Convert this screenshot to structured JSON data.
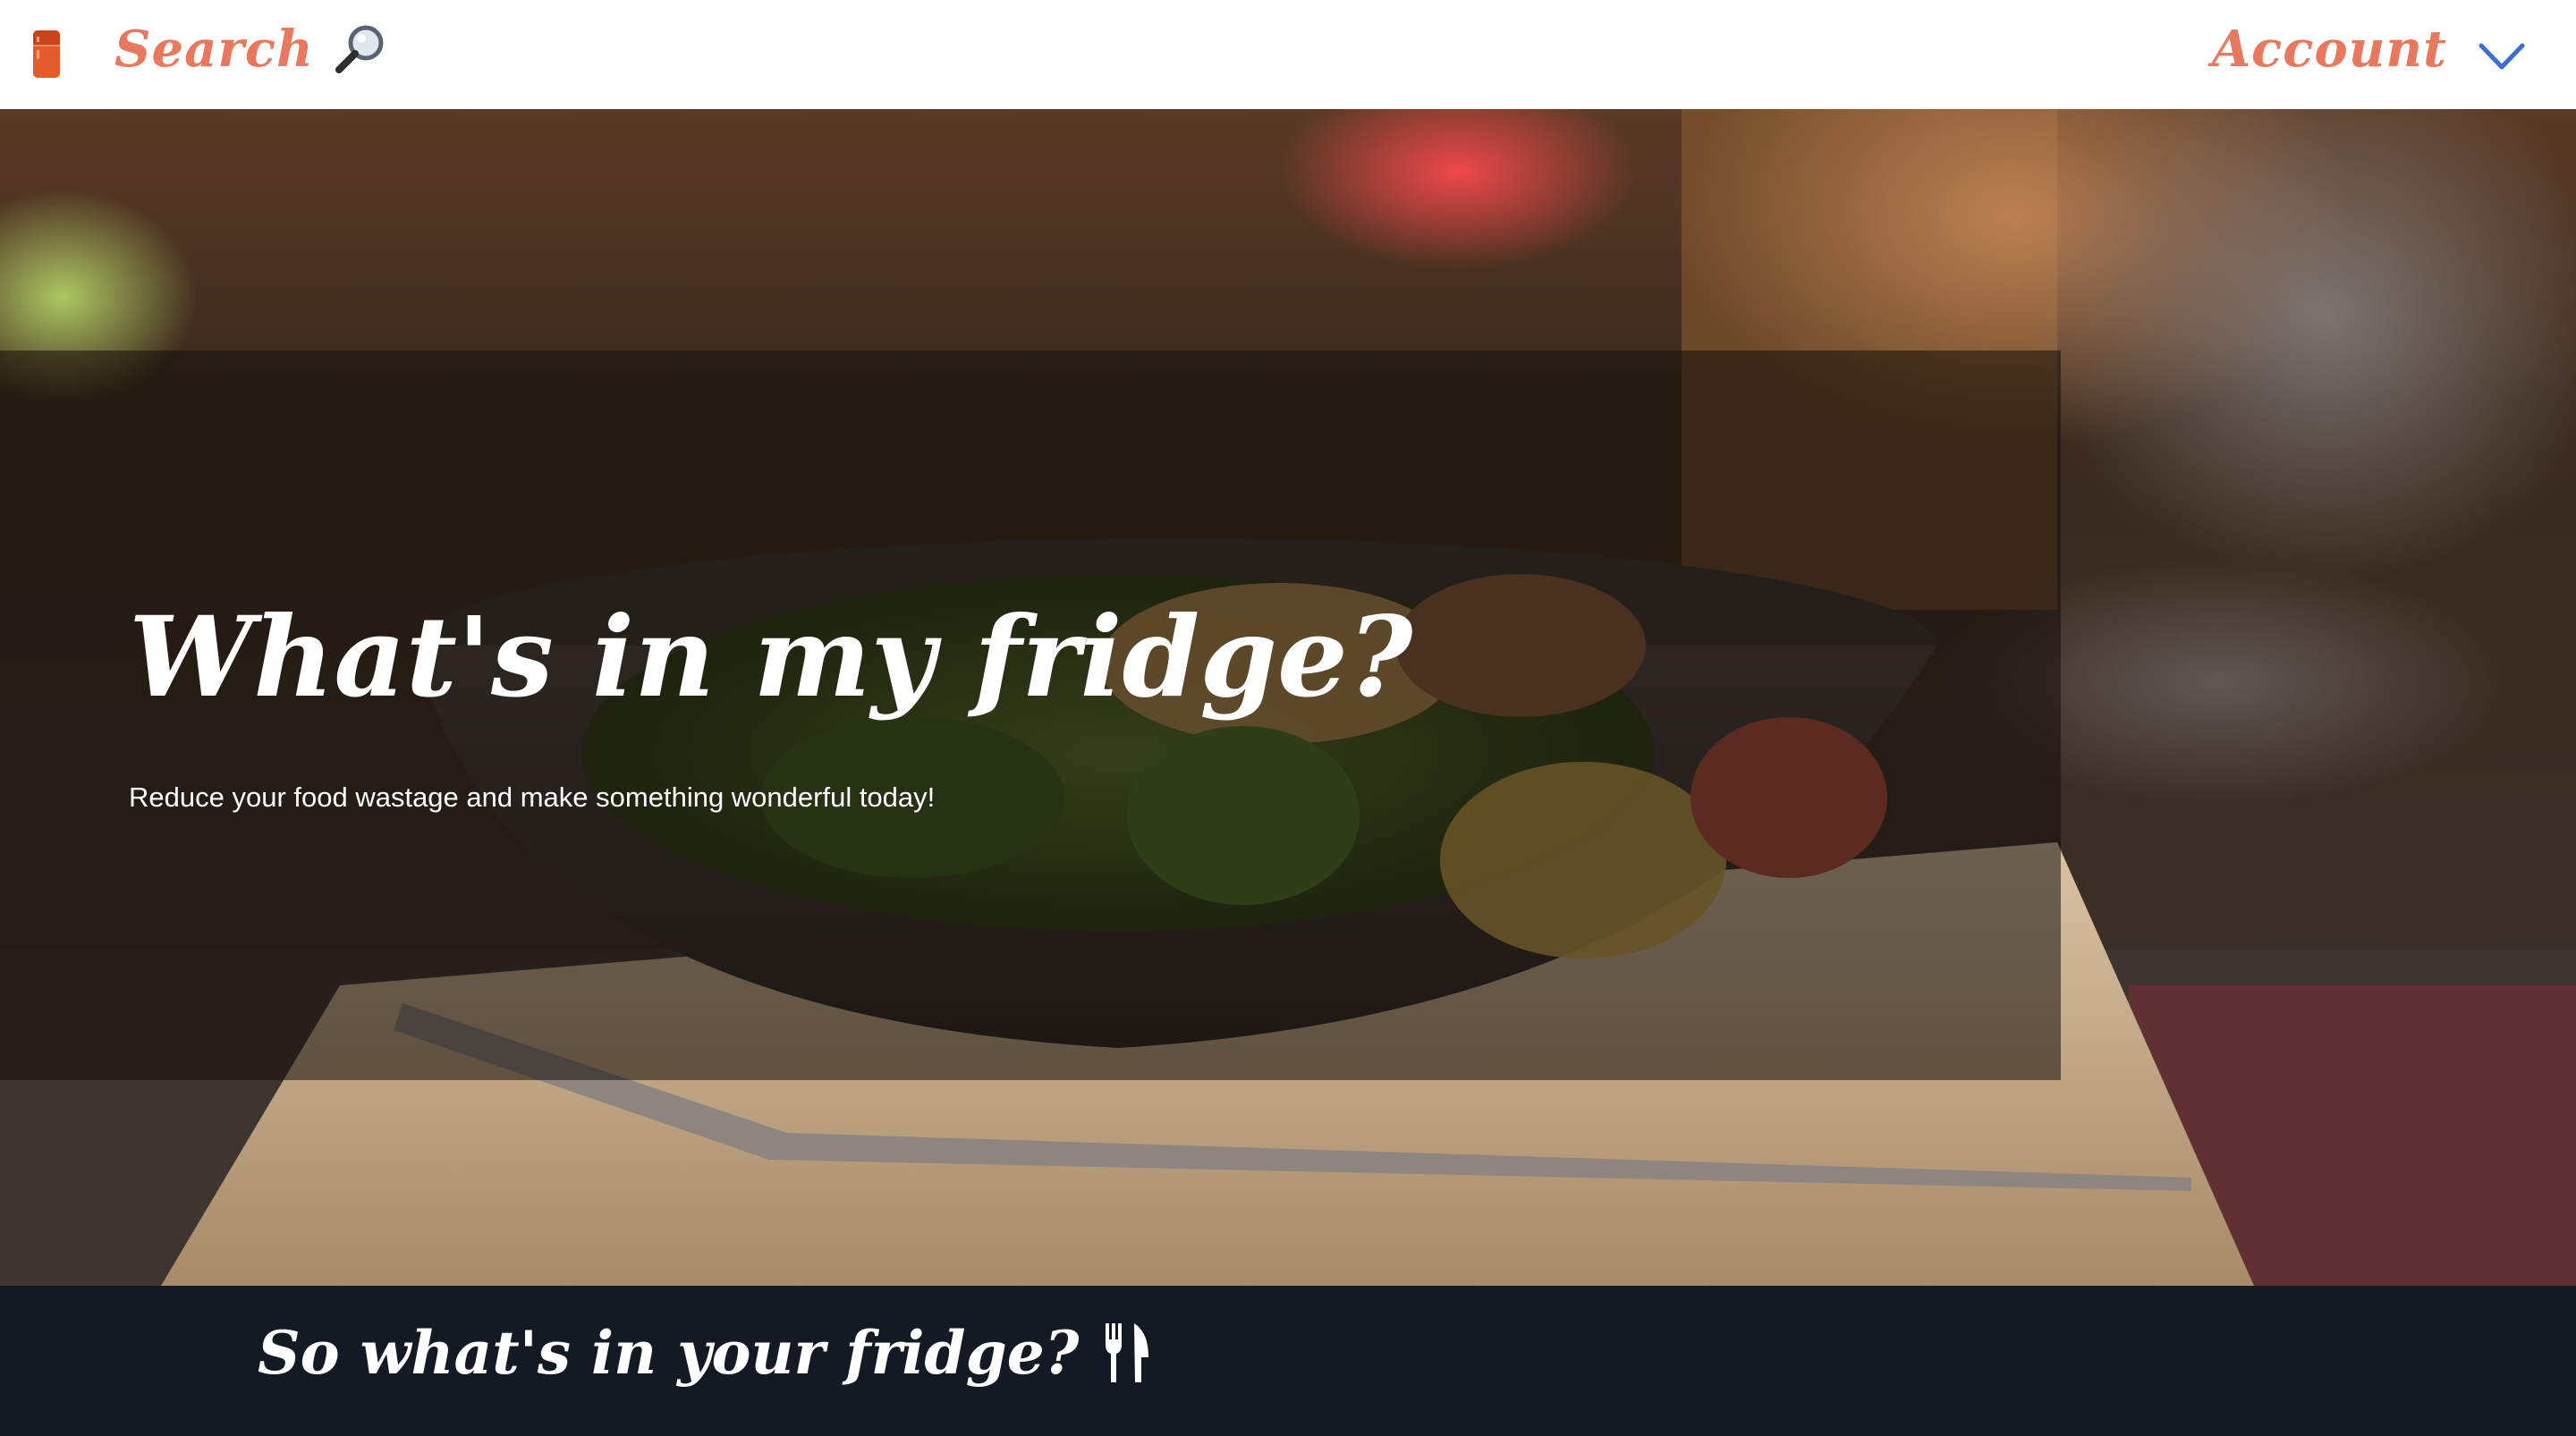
{
  "nav": {
    "brand_icon": "fridge-icon",
    "search_label": "Search",
    "search_icon": "magnifying-glass-icon",
    "account_label": "Account",
    "account_icon": "chevron-down-icon"
  },
  "hero": {
    "title": "What's in my fridge?",
    "subtitle": "Reduce your food wastage and make something wonderful today!"
  },
  "section": {
    "heading": "So what's in your fridge?",
    "heading_icon": "fork-knife-icon"
  },
  "colors": {
    "accent": "#e8795e",
    "chevron": "#3a6fd0",
    "band_bg": "#141a24",
    "brand_icon": "#e35d2c"
  }
}
